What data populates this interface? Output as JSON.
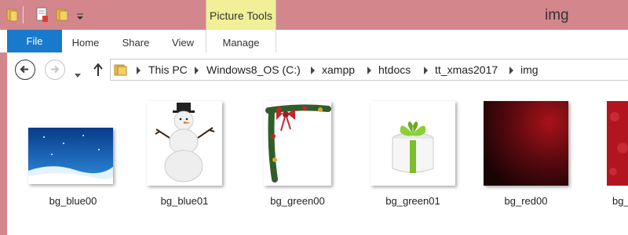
{
  "window": {
    "title": "img"
  },
  "ribbon": {
    "context_title": "Picture Tools",
    "tabs": [
      {
        "label": "File"
      },
      {
        "label": "Home"
      },
      {
        "label": "Share"
      },
      {
        "label": "View"
      },
      {
        "label": "Manage"
      }
    ]
  },
  "quick_access": {
    "icons": [
      "folder-icon",
      "properties-icon",
      "new-folder-icon",
      "customize-dropdown-icon"
    ]
  },
  "navigation": {
    "buttons": [
      "back-icon",
      "forward-icon",
      "recent-locations-icon",
      "up-icon"
    ]
  },
  "address": {
    "crumbs": [
      "This PC",
      "Windows8_OS (C:)",
      "xampp",
      "htdocs",
      "tt_xmas2017",
      "img"
    ]
  },
  "files": [
    {
      "name": "bg_blue00",
      "icon": "winter-landscape-thumbnail"
    },
    {
      "name": "bg_blue01",
      "icon": "snowman-thumbnail"
    },
    {
      "name": "bg_green00",
      "icon": "holly-garland-thumbnail"
    },
    {
      "name": "bg_green01",
      "icon": "gift-box-thumbnail"
    },
    {
      "name": "bg_red00",
      "icon": "dark-red-thumbnail"
    },
    {
      "name": "bg_",
      "icon": "red-pattern-thumbnail"
    }
  ],
  "colors": {
    "titlebar": "#d3878d",
    "context_tab": "#f1ef98",
    "file_tab": "#1979ca"
  }
}
